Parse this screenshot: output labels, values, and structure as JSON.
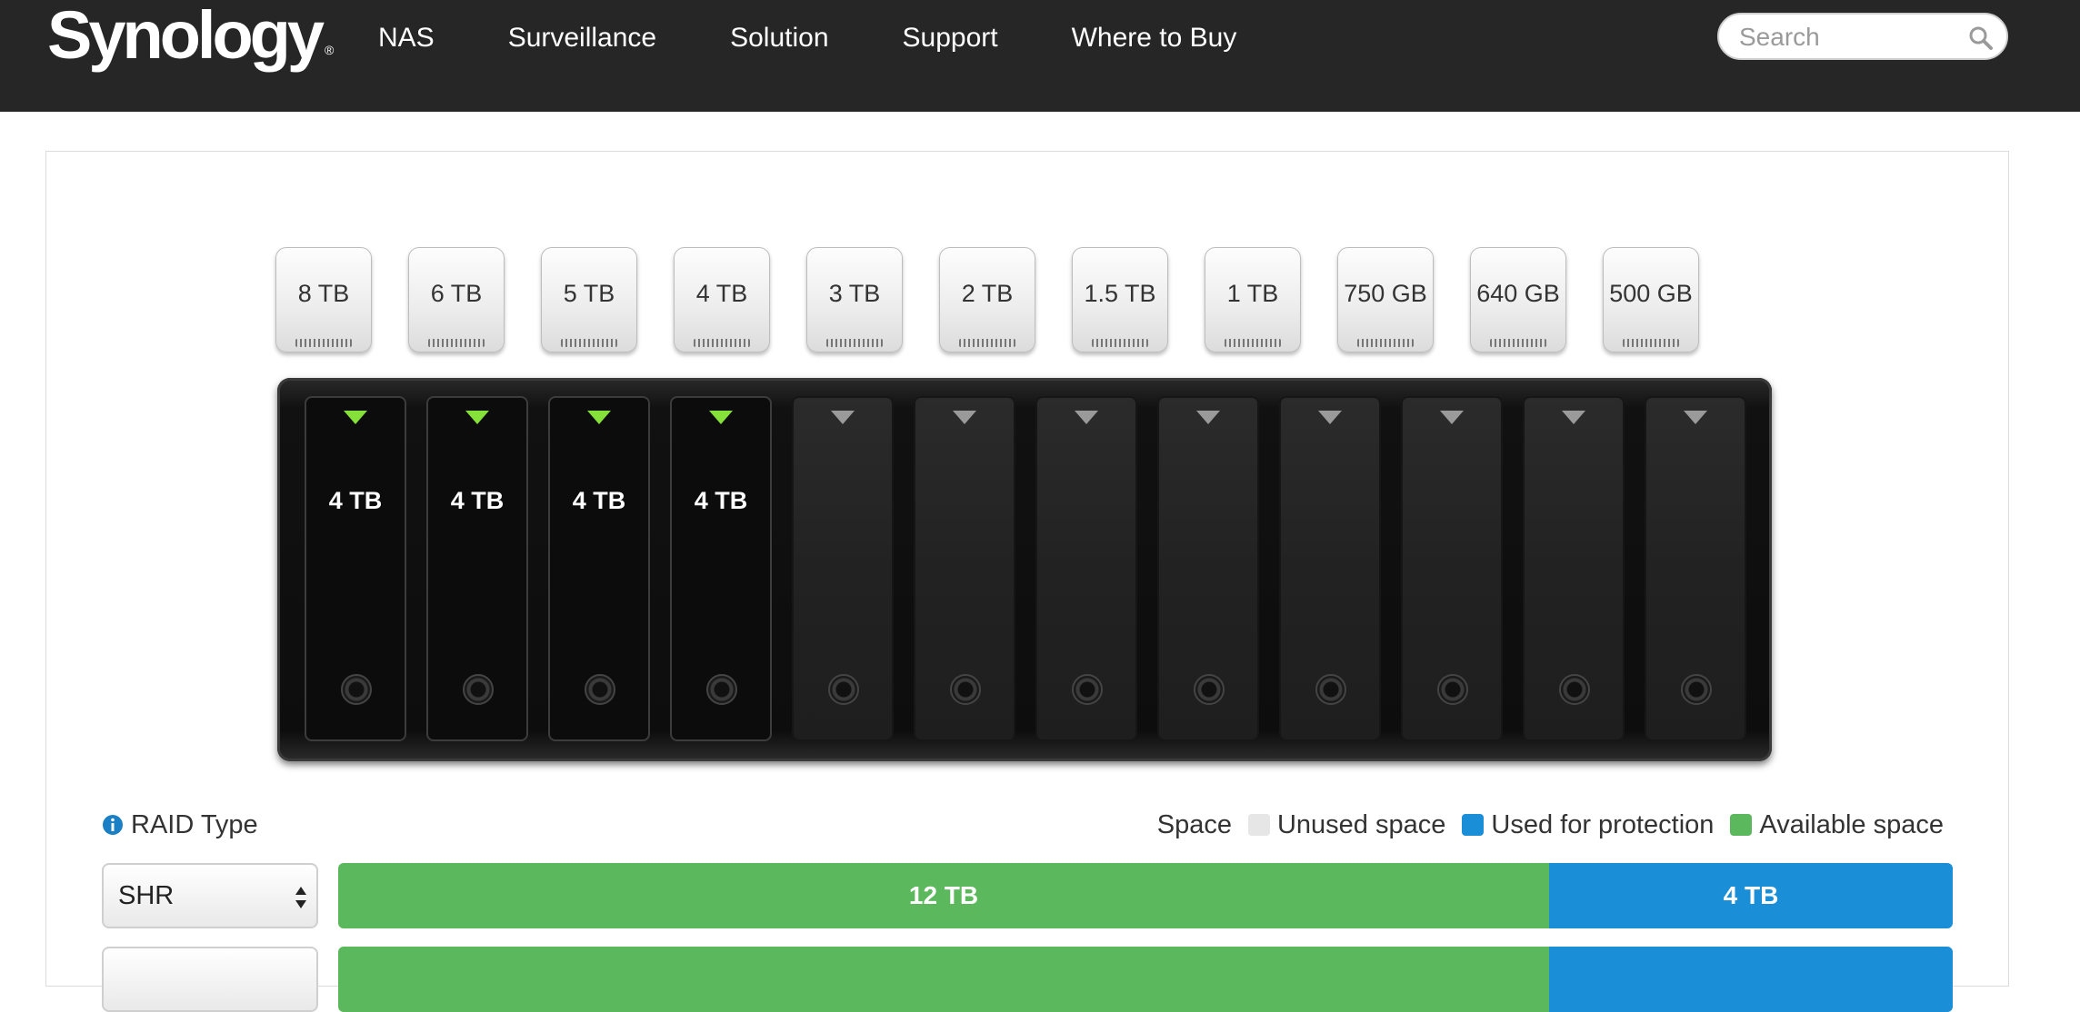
{
  "header": {
    "logo": "Synology",
    "logo_mark": "®",
    "nav": [
      "NAS",
      "Surveillance",
      "Solution",
      "Support",
      "Where to Buy"
    ],
    "search_placeholder": "Search",
    "search_icon": "search-icon"
  },
  "drives": [
    "8 TB",
    "6 TB",
    "5 TB",
    "4 TB",
    "3 TB",
    "2 TB",
    "1.5 TB",
    "1 TB",
    "750 GB",
    "640 GB",
    "500 GB"
  ],
  "bays": {
    "total": 12,
    "installed": [
      "4 TB",
      "4 TB",
      "4 TB",
      "4 TB"
    ]
  },
  "raid": {
    "label": "RAID Type",
    "info_icon": "info-icon",
    "rows": [
      {
        "select": "SHR",
        "available": "12 TB",
        "protection": "4 TB",
        "available_value": 12,
        "protection_value": 4
      },
      {
        "select": "",
        "available": "",
        "protection": "",
        "available_value": 12,
        "protection_value": 4
      }
    ]
  },
  "legend": {
    "title": "Space",
    "items": [
      {
        "label": "Unused space",
        "color": "#e6e6e6"
      },
      {
        "label": "Used for protection",
        "color": "#1a8ed6"
      },
      {
        "label": "Available space",
        "color": "#5cb85c"
      }
    ]
  }
}
